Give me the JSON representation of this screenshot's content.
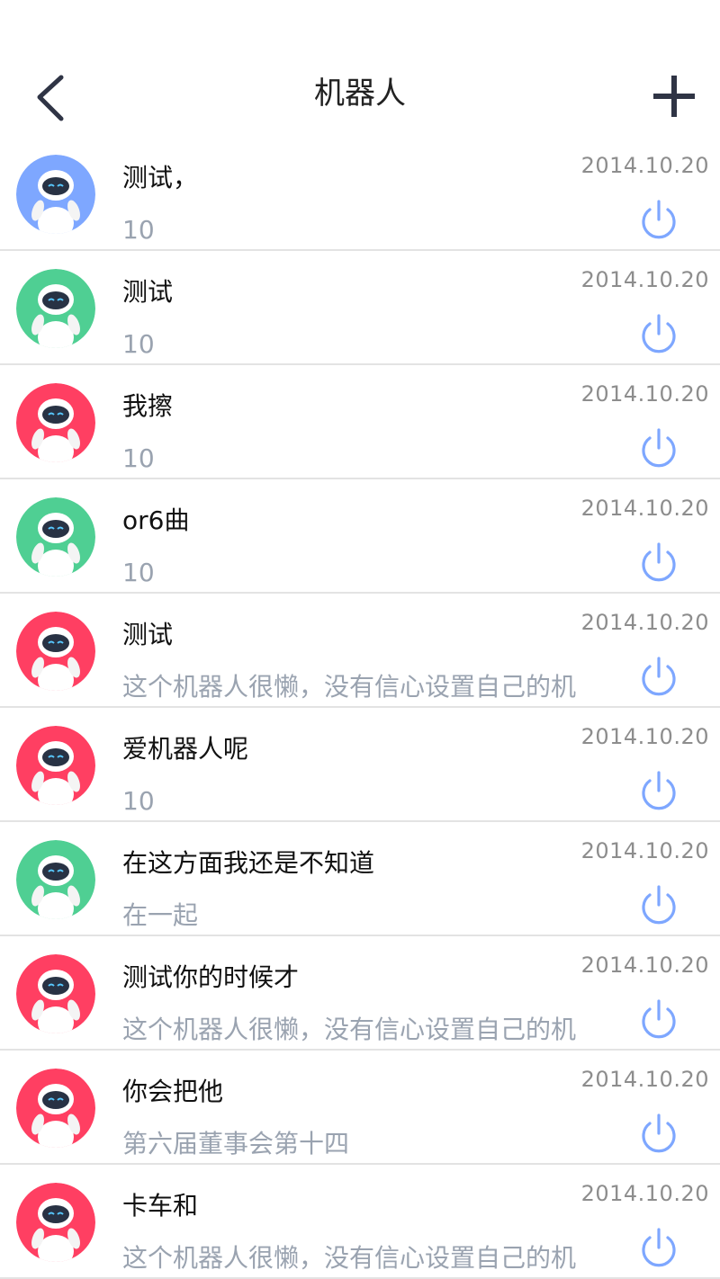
{
  "header": {
    "title": "机器人",
    "back_icon": "chevron-left-icon",
    "add_icon": "plus-icon"
  },
  "colors": {
    "blue": "#7ea7ff",
    "green": "#4fcf93",
    "red": "#ff3f62",
    "power": "#7ea7ff"
  },
  "robots": [
    {
      "name": "测试，",
      "subtitle": "10",
      "date": "2014.10.20",
      "avatar_color": "blue"
    },
    {
      "name": "测试",
      "subtitle": "10",
      "date": "2014.10.20",
      "avatar_color": "green"
    },
    {
      "name": "我擦",
      "subtitle": "10",
      "date": "2014.10.20",
      "avatar_color": "red"
    },
    {
      "name": "or6曲",
      "subtitle": "10",
      "date": "2014.10.20",
      "avatar_color": "green"
    },
    {
      "name": "测试",
      "subtitle": "这个机器人很懒，没有信心设置自己的机",
      "date": "2014.10.20",
      "avatar_color": "red"
    },
    {
      "name": "爱机器人呢",
      "subtitle": "10",
      "date": "2014.10.20",
      "avatar_color": "red"
    },
    {
      "name": "在这方面我还是不知道",
      "subtitle": "在一起",
      "date": "2014.10.20",
      "avatar_color": "green"
    },
    {
      "name": "测试你的时候才",
      "subtitle": "这个机器人很懒，没有信心设置自己的机",
      "date": "2014.10.20",
      "avatar_color": "red"
    },
    {
      "name": "你会把他",
      "subtitle": "第六届董事会第十四",
      "date": "2014.10.20",
      "avatar_color": "red"
    },
    {
      "name": "卡车和",
      "subtitle": "这个机器人很懒，没有信心设置自己的机",
      "date": "2014.10.20",
      "avatar_color": "red"
    }
  ]
}
